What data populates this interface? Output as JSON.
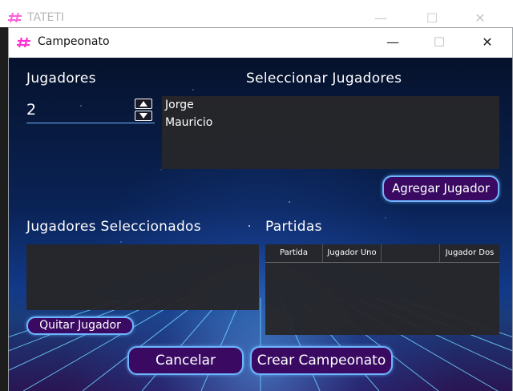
{
  "parent_window": {
    "title": "TATETI",
    "minimize_glyph": "—",
    "maximize_glyph": "☐",
    "close_glyph": "✕"
  },
  "dialog": {
    "title": "Campeonato",
    "minimize_glyph": "—",
    "maximize_glyph": "☐",
    "close_glyph": "✕"
  },
  "players_count": {
    "label": "Jugadores",
    "value": "2"
  },
  "select_players": {
    "label": "Seleccionar Jugadores",
    "items": [
      "Jorge",
      "Mauricio"
    ],
    "add_button": "Agregar Jugador"
  },
  "selected_players": {
    "label": "Jugadores Seleccionados",
    "items": [],
    "remove_button": "Quitar Jugador"
  },
  "matches": {
    "label": "Partidas",
    "columns": [
      "Partida",
      "Jugador Uno",
      "",
      "Jugador Dos"
    ],
    "rows": []
  },
  "footer": {
    "cancel_button": "Cancelar",
    "create_button": "Crear Campeonato"
  },
  "icons": {
    "app_logo": "hash-logo-icon",
    "spin_up": "chevron-up-icon",
    "spin_down": "chevron-down-icon"
  },
  "colors": {
    "accent_border": "#6db6ff",
    "button_fill": "#3a0a63",
    "logo": "#ff2fd1",
    "list_bg": "#26262a"
  }
}
